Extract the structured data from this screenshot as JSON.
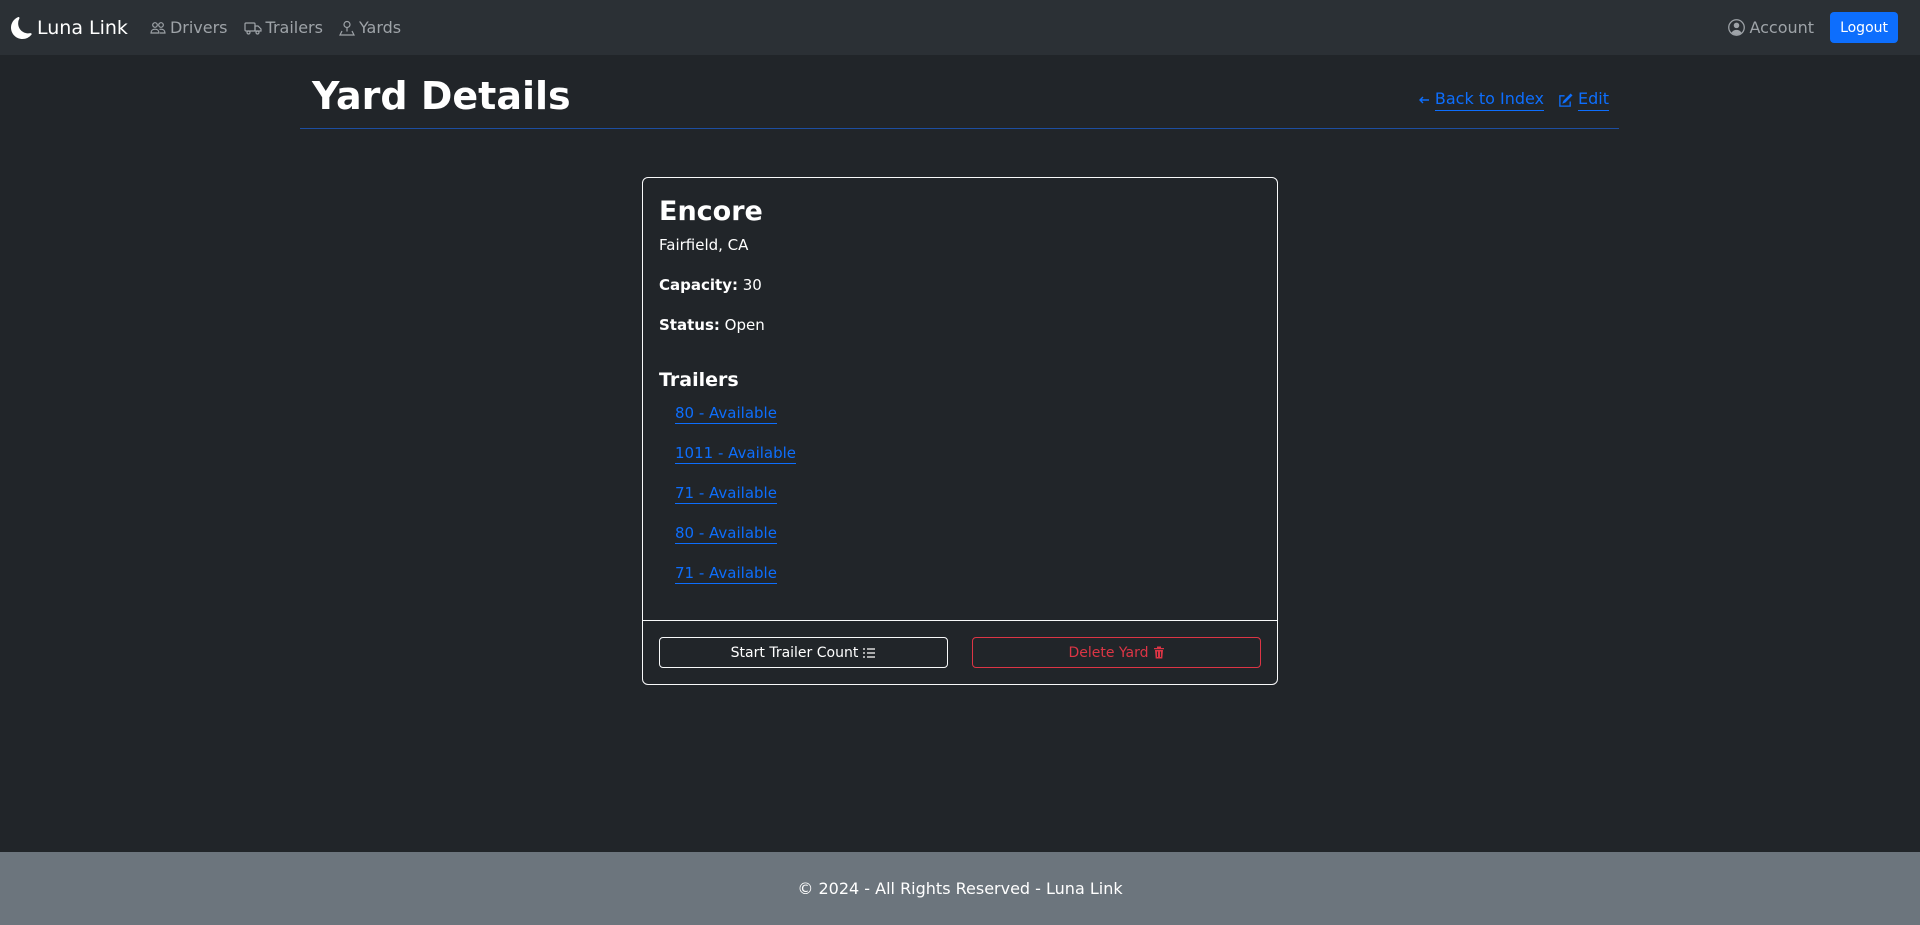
{
  "navbar": {
    "brand": "Luna Link",
    "brand_icon": "moon-icon",
    "links": [
      {
        "label": "Drivers",
        "icon": "people-icon"
      },
      {
        "label": "Trailers",
        "icon": "truck-icon"
      },
      {
        "label": "Yards",
        "icon": "pin-person-icon"
      }
    ],
    "account_label": "Account",
    "account_icon": "person-circle-icon",
    "logout_label": "Logout"
  },
  "header": {
    "title": "Yard Details",
    "back_label": "Back to Index",
    "back_icon": "arrow-left-icon",
    "edit_label": "Edit",
    "edit_icon": "pencil-square-icon"
  },
  "yard": {
    "name": "Encore",
    "location": "Fairfield, CA",
    "capacity_label": "Capacity:",
    "capacity_value": "30",
    "status_label": "Status:",
    "status_value": "Open",
    "trailers_heading": "Trailers",
    "trailers": [
      {
        "label": "80 - Available"
      },
      {
        "label": "1011 - Available"
      },
      {
        "label": "71 - Available"
      },
      {
        "label": "80 - Available"
      },
      {
        "label": "71 - Available"
      }
    ]
  },
  "actions": {
    "start_count_label": "Start Trailer Count",
    "start_count_icon": "list-check-icon",
    "delete_label": "Delete Yard",
    "delete_icon": "trash-icon"
  },
  "colors": {
    "primary": "#0d6efd",
    "danger": "#dc3545",
    "navbar_bg": "#2b3035",
    "body_bg": "#212529",
    "footer_bg": "#6c757d"
  },
  "footer": {
    "text": "© 2024 - All Rights Reserved - Luna Link"
  }
}
